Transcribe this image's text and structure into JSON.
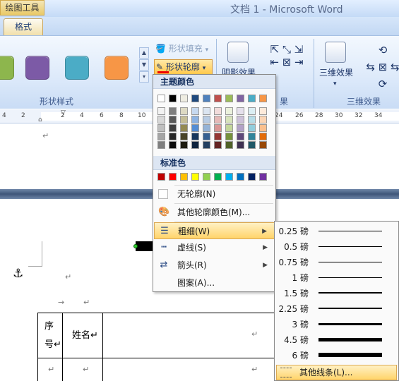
{
  "titlebar": {
    "tools_label": "绘图工具",
    "window_title": "文档 1 - Microsoft Word"
  },
  "tabs": {
    "format": "格式"
  },
  "ribbon": {
    "style_swatch_colors": [
      "#8db64d",
      "#7c5aa6",
      "#4bacc6",
      "#f79646"
    ],
    "shape_fill": "形状填充",
    "shape_outline": "形状轮廓",
    "shadow_effect": "阴影效果",
    "three_d": "三维效果",
    "groups": {
      "shape_styles": "形状样式",
      "shadow_tail": "果",
      "three_d": "三维效果"
    }
  },
  "ruler": {
    "labels": [
      "4",
      "2",
      "2",
      "4",
      "6",
      "8",
      "10",
      "24",
      "26",
      "28",
      "30",
      "32",
      "34"
    ]
  },
  "document": {
    "para_mark": "↵",
    "tab_mark": "→",
    "table": {
      "header_cells": [
        "序号↵",
        "姓名↵",
        "↵"
      ],
      "row2": [
        "↵",
        "↵",
        "↵"
      ]
    }
  },
  "outline_menu": {
    "theme_colors_header": "主题颜色",
    "theme_top_row": [
      "#ffffff",
      "#000000",
      "#eeece1",
      "#1f497d",
      "#4f81bd",
      "#c0504d",
      "#9bbb59",
      "#8064a2",
      "#4bacc6",
      "#f79646"
    ],
    "theme_shades": [
      [
        "#f2f2f2",
        "#d8d8d8",
        "#bfbfbf",
        "#a5a5a5",
        "#7f7f7f"
      ],
      [
        "#7f7f7f",
        "#595959",
        "#3f3f3f",
        "#262626",
        "#0c0c0c"
      ],
      [
        "#ddd9c3",
        "#c4bd97",
        "#938953",
        "#494429",
        "#1d1b10"
      ],
      [
        "#c6d9f0",
        "#8db3e2",
        "#548dd4",
        "#17365d",
        "#0f243e"
      ],
      [
        "#dbe5f1",
        "#b8cce4",
        "#95b3d7",
        "#366092",
        "#244061"
      ],
      [
        "#f2dcdb",
        "#e5b9b7",
        "#d99694",
        "#953734",
        "#632423"
      ],
      [
        "#ebf1dd",
        "#d7e3bc",
        "#c3d69b",
        "#76923c",
        "#4f6128"
      ],
      [
        "#e5e0ec",
        "#ccc1d9",
        "#b2a2c7",
        "#5f497a",
        "#3f3151"
      ],
      [
        "#dbeef3",
        "#b7dde8",
        "#92cddc",
        "#31859b",
        "#205867"
      ],
      [
        "#fdeada",
        "#fbd5b5",
        "#fac08f",
        "#e36c09",
        "#974806"
      ]
    ],
    "standard_colors_header": "标准色",
    "standard_colors": [
      "#c00000",
      "#ff0000",
      "#ffc000",
      "#ffff00",
      "#92d050",
      "#00b050",
      "#00b0f0",
      "#0070c0",
      "#002060",
      "#7030a0"
    ],
    "no_outline": "无轮廓(N)",
    "more_colors": "其他轮廓颜色(M)...",
    "weight": "粗细(W)",
    "dashes": "虚线(S)",
    "arrows": "箭头(R)",
    "pattern": "图案(A)..."
  },
  "weight_menu": {
    "items": [
      {
        "label": "0.25 磅",
        "weight": 0.25
      },
      {
        "label": "0.5 磅",
        "weight": 0.5
      },
      {
        "label": "0.75 磅",
        "weight": 0.75
      },
      {
        "label": "1 磅",
        "weight": 1
      },
      {
        "label": "1.5 磅",
        "weight": 1.5
      },
      {
        "label": "2.25 磅",
        "weight": 2.25
      },
      {
        "label": "3 磅",
        "weight": 3
      },
      {
        "label": "4.5 磅",
        "weight": 4.5
      },
      {
        "label": "6 磅",
        "weight": 6
      }
    ],
    "more_lines": "其他线条(L)..."
  }
}
